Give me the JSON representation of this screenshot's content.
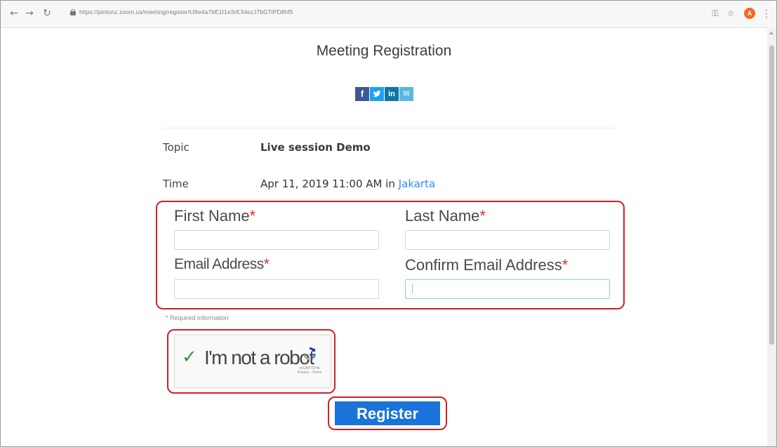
{
  "browser": {
    "url": "https://pintonz.zoom.us/meeting/register/tJ8e4a7bE1I1e3rE34ezJ7bGTiPD8hf5",
    "icons": [
      "back-icon",
      "forward-icon",
      "reload-icon",
      "lock-icon",
      "key-icon",
      "star-icon",
      "profile-icon",
      "menu-icon"
    ]
  },
  "page": {
    "title": "Meeting Registration",
    "share": {
      "facebook": "f",
      "twitter": "t",
      "linkedin": "in",
      "email": "✉"
    }
  },
  "meeting": {
    "topic_label": "Topic",
    "topic_value": "Live session Demo",
    "time_label": "Time",
    "time_value": "Apr 11, 2019 11:00 AM in ",
    "timezone": "Jakarta"
  },
  "form": {
    "first_name_label": "First Name",
    "last_name_label": "Last Name",
    "email_label": "Email Address",
    "confirm_email_label": "Confirm Email Address",
    "required_marker": "*",
    "first_name_value": "",
    "last_name_value": "",
    "email_value": "",
    "confirm_email_value": "",
    "required_note": "* Required information"
  },
  "captcha": {
    "checkmark": "✓",
    "label": "I'm not a robot",
    "brand": "reCAPTCHA",
    "links": "Privacy - Terms"
  },
  "actions": {
    "register_label": "Register"
  },
  "colors": {
    "accent": "#1a73d9",
    "link": "#2d8cff",
    "required": "#d0352e",
    "annotation": "#d41e26"
  }
}
